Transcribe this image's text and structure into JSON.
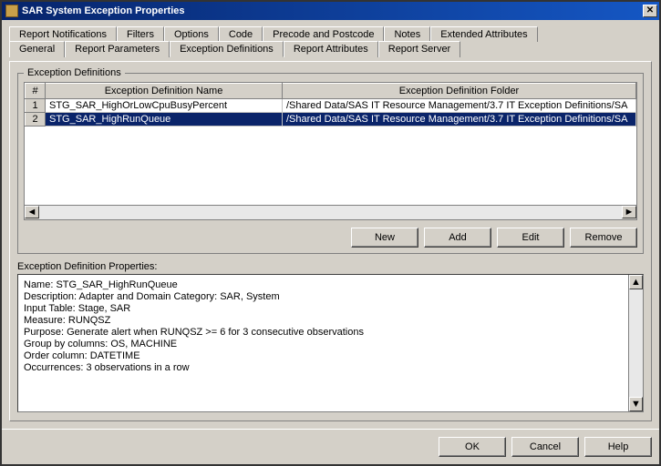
{
  "window": {
    "title": "SAR System Exception Properties"
  },
  "tabs": {
    "row1": [
      {
        "label": "Report Notifications"
      },
      {
        "label": "Filters"
      },
      {
        "label": "Options"
      },
      {
        "label": "Code"
      },
      {
        "label": "Precode and Postcode"
      },
      {
        "label": "Notes"
      },
      {
        "label": "Extended Attributes"
      }
    ],
    "row2": [
      {
        "label": "General"
      },
      {
        "label": "Report Parameters"
      },
      {
        "label": "Exception Definitions",
        "selected": true
      },
      {
        "label": "Report Attributes"
      },
      {
        "label": "Report Server"
      }
    ]
  },
  "groupbox": {
    "legend": "Exception Definitions"
  },
  "table": {
    "headers": {
      "index": "#",
      "name": "Exception Definition Name",
      "folder": "Exception Definition Folder"
    },
    "rows": [
      {
        "index": "1",
        "name": "STG_SAR_HighOrLowCpuBusyPercent",
        "folder": "/Shared Data/SAS IT Resource Management/3.7 IT Exception Definitions/SA",
        "selected": false
      },
      {
        "index": "2",
        "name": "STG_SAR_HighRunQueue",
        "folder": "/Shared Data/SAS IT Resource Management/3.7 IT Exception Definitions/SA",
        "selected": true
      }
    ]
  },
  "crud": {
    "new": "New",
    "add": "Add",
    "edit": "Edit",
    "remove": "Remove"
  },
  "propsLabel": "Exception Definition Properties:",
  "props": {
    "lines": [
      "Name: STG_SAR_HighRunQueue",
      "Description: Adapter and Domain Category: SAR, System",
      "Input Table: Stage, SAR",
      "Measure: RUNQSZ",
      "Purpose: Generate alert when RUNQSZ >= 6 for 3 consecutive observations",
      "Group by columns: OS, MACHINE",
      "Order column: DATETIME",
      "Occurrences: 3 observations in a row"
    ]
  },
  "footer": {
    "ok": "OK",
    "cancel": "Cancel",
    "help": "Help"
  }
}
